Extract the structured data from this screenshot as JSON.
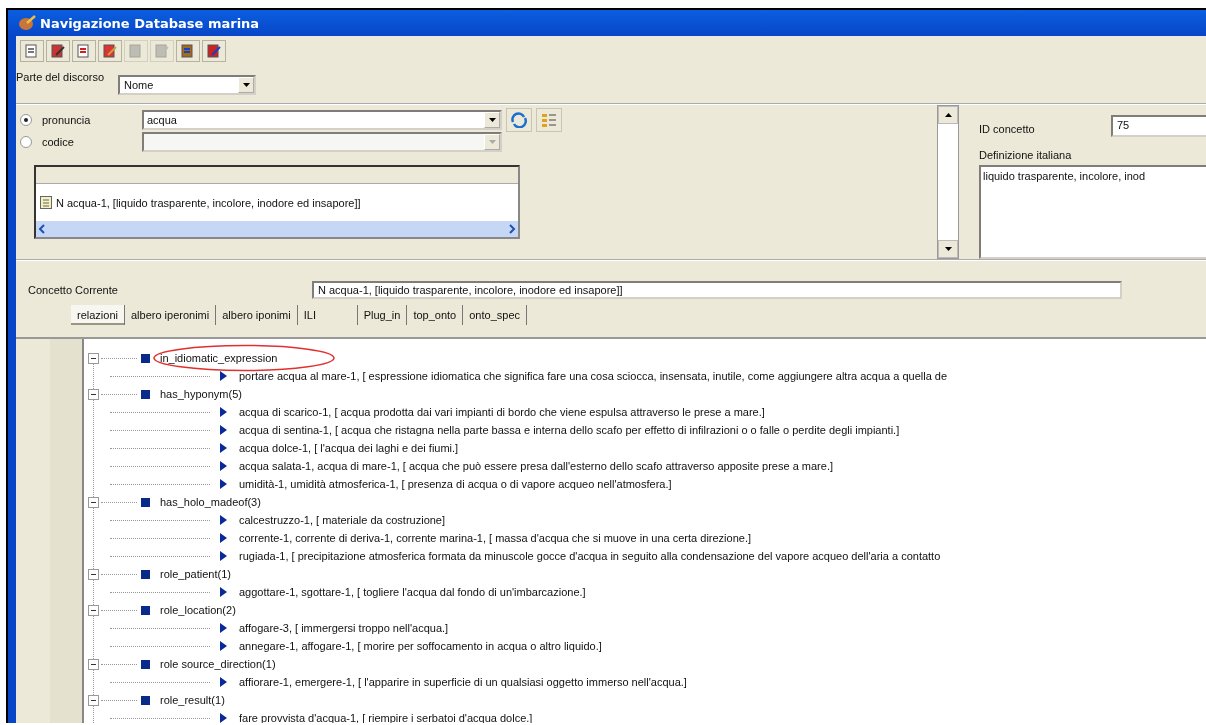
{
  "window": {
    "title": "Navigazione Database marina"
  },
  "toolbar": [
    {
      "disabled": false
    },
    {
      "disabled": false
    },
    {
      "disabled": false
    },
    {
      "disabled": false
    },
    {
      "disabled": true
    },
    {
      "disabled": true
    },
    {
      "disabled": false
    },
    {
      "disabled": false
    }
  ],
  "part_of_speech": {
    "label": "Parte del discorso",
    "value": "Nome"
  },
  "search": {
    "fields": [
      {
        "label": "pronuncia",
        "selected": true,
        "disabled": false,
        "value": "acqua"
      },
      {
        "label": "codice",
        "selected": false,
        "disabled": true
      }
    ],
    "results": [
      {
        "text": "N acqua-1,  [liquido trasparente, incolore, inodore ed insapore]]"
      }
    ]
  },
  "concept": {
    "id_label": "ID concetto",
    "id_value": "75",
    "definition_label": "Definizione italiana",
    "definition": "liquido trasparente, incolore, inod"
  },
  "current_concept": {
    "label": "Concetto Corrente",
    "value": "N acqua-1,  [liquido trasparente, incolore, inodore ed insapore]]"
  },
  "tabs": [
    {
      "label": "relazioni",
      "selected": true
    },
    {
      "label": "albero iperonimi",
      "selected": false
    },
    {
      "label": "albero iponimi",
      "selected": false
    },
    {
      "label": "ILI",
      "selected": false
    },
    {
      "label": "Plug_in",
      "selected": false
    },
    {
      "label": "top_onto",
      "selected": false
    },
    {
      "label": "onto_spec",
      "selected": false
    }
  ],
  "tree": [
    {
      "label": "in_idiomatic_expression",
      "expanded": true,
      "children": [
        {
          "text": "portare acqua al mare-1,  [  espressione idiomatica che significa fare una cosa sciocca, insensata, inutile, come aggiungere altra acqua a quella de"
        }
      ]
    },
    {
      "label": "has_hyponym(5)",
      "expanded": true,
      "children": [
        {
          "text": "acqua di scarico-1,  [  acqua prodotta dai vari impianti di bordo che viene espulsa attraverso le prese a mare.]"
        },
        {
          "text": "acqua di sentina-1,  [  acqua che ristagna nella parte bassa e interna dello scafo per effetto di infilrazioni o o falle o perdite degli impianti.]"
        },
        {
          "text": "acqua dolce-1,  [  l'acqua dei laghi e dei fiumi.]"
        },
        {
          "text": "acqua salata-1,  acqua di mare-1,  [  acqua che può essere presa dall'esterno dello scafo attraverso apposite prese a mare.]"
        },
        {
          "text": "umidità-1,  umidità atmosferica-1,  [  presenza di acqua o di vapore acqueo nell'atmosfera.]"
        }
      ]
    },
    {
      "label": "has_holo_madeof(3)",
      "expanded": true,
      "children": [
        {
          "text": "calcestruzzo-1,  [  materiale da costruzione]"
        },
        {
          "text": "corrente-1,  corrente di deriva-1,  corrente marina-1,  [  massa d'acqua che si muove in una certa direzione.]"
        },
        {
          "text": "rugiada-1,  [  precipitazione atmosferica formata da minuscole gocce d'acqua in seguito alla condensazione del vapore acqueo dell'aria a contatto"
        }
      ]
    },
    {
      "label": "role_patient(1)",
      "expanded": true,
      "children": [
        {
          "text": "aggottare-1,  sgottare-1,  [  togliere l'acqua dal fondo di un'imbarcazione.]"
        }
      ]
    },
    {
      "label": "role_location(2)",
      "expanded": true,
      "children": [
        {
          "text": "affogare-3,  [  immergersi troppo nell'acqua.]"
        },
        {
          "text": "annegare-1,  affogare-1,  [  morire per soffocamento in acqua o altro liquido.]"
        }
      ]
    },
    {
      "label": "role source_direction(1)",
      "expanded": true,
      "children": [
        {
          "text": "affiorare-1,  emergere-1,  [  l'apparire in superficie di un qualsiasi oggetto immerso nell'acqua.]"
        }
      ]
    },
    {
      "label": "role_result(1)",
      "expanded": true,
      "children": [
        {
          "text": "fare provvista d'acqua-1,  [  riempire i serbatoi d'acqua dolce.]"
        }
      ]
    }
  ]
}
